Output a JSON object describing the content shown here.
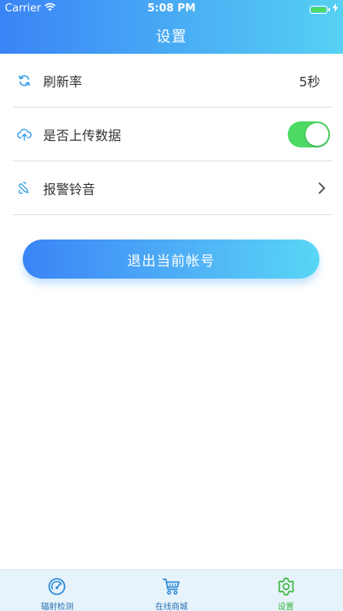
{
  "status_bar": {
    "carrier": "Carrier",
    "time": "5:08 PM"
  },
  "nav": {
    "title": "设置"
  },
  "settings": [
    {
      "label": "刷新率",
      "value": "5秒",
      "icon": "refresh-icon"
    },
    {
      "label": "是否上传数据",
      "toggle_on": true,
      "icon": "cloud-upload-icon"
    },
    {
      "label": "报警铃音",
      "icon": "bell-icon",
      "accessory": "chevron-right-icon"
    }
  ],
  "logout_button": {
    "label": "退出当前帐号"
  },
  "tabs": [
    {
      "label": "辐射检测",
      "icon": "gauge-icon",
      "active": false
    },
    {
      "label": "在线商城",
      "icon": "cart-icon",
      "active": false
    },
    {
      "label": "设置",
      "icon": "gear-icon",
      "active": true
    }
  ],
  "colors": {
    "header_gradient_start": "#3a84f6",
    "header_gradient_end": "#56d1f3",
    "toggle_on": "#4cd964",
    "tab_active": "#38b43a",
    "tab_inactive": "#2c6fb3",
    "icon_blue": "#3aa0e8"
  }
}
